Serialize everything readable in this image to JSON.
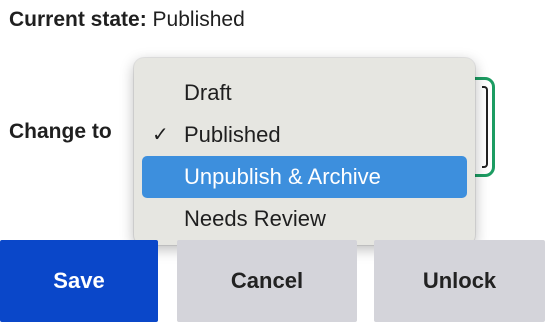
{
  "current_state": {
    "label": "Current state:",
    "value": "Published"
  },
  "change_to": {
    "label": "Change to"
  },
  "dropdown": {
    "selected": "Published",
    "highlighted": "Unpublish & Archive",
    "check_icon": "✓",
    "options": [
      {
        "label": "Draft"
      },
      {
        "label": "Published"
      },
      {
        "label": "Unpublish & Archive"
      },
      {
        "label": "Needs Review"
      }
    ],
    "focus_color": "#1c9c62",
    "highlight_color": "#3d8fdd"
  },
  "buttons": {
    "save": "Save",
    "cancel": "Cancel",
    "unlock": "Unlock"
  },
  "colors": {
    "save_bg": "#0a47c9",
    "secondary_bg": "#d4d4da"
  }
}
